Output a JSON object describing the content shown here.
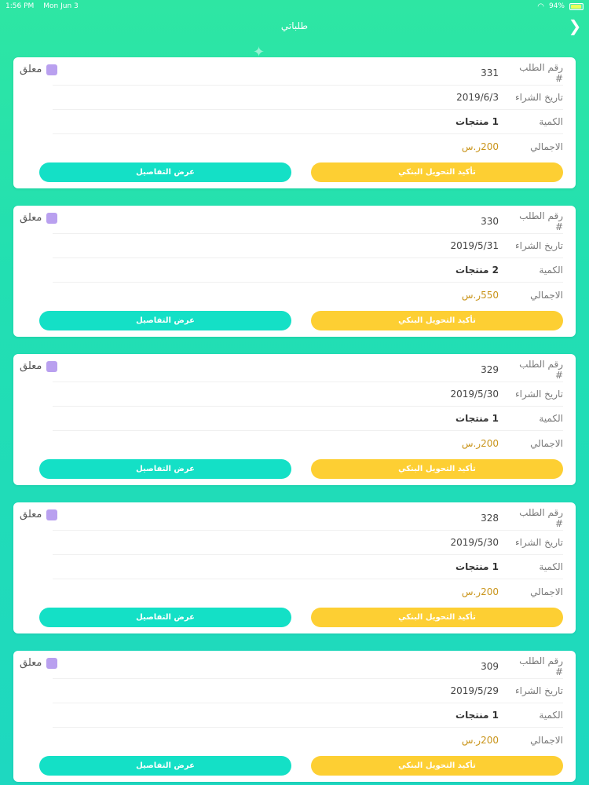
{
  "status_bar": {
    "time": "1:56 PM",
    "date": "Mon Jun 3",
    "battery": "94%"
  },
  "header": {
    "title": "طلباتي"
  },
  "labels": {
    "order_no": "رقم الطلب #",
    "purchase_date": "تاريخ الشراء",
    "quantity": "الكمية",
    "total": "الاجمالي",
    "status": "معلق",
    "confirm_button": "تأكيد التحويل البنكي",
    "details_button": "عرض التفاصيل"
  },
  "orders": [
    {
      "order_no": "331",
      "date": "2019/6/3",
      "quantity": "1  منتجات",
      "total": "200ر.س"
    },
    {
      "order_no": "330",
      "date": "2019/5/31",
      "quantity": "2  منتجات",
      "total": "550ر.س"
    },
    {
      "order_no": "329",
      "date": "2019/5/30",
      "quantity": "1  منتجات",
      "total": "200ر.س"
    },
    {
      "order_no": "328",
      "date": "2019/5/30",
      "quantity": "1  منتجات",
      "total": "200ر.س"
    },
    {
      "order_no": "309",
      "date": "2019/5/29",
      "quantity": "1  منتجات",
      "total": "200ر.س"
    }
  ],
  "colors": {
    "accent_teal": "#14e0c6",
    "accent_yellow": "#fdcf33",
    "status_purple": "#b9a0ef",
    "money_gold": "#c9941a"
  },
  "icons": {
    "back": "chevron-right-icon",
    "wifi": "wifi-icon",
    "battery": "battery-icon"
  }
}
